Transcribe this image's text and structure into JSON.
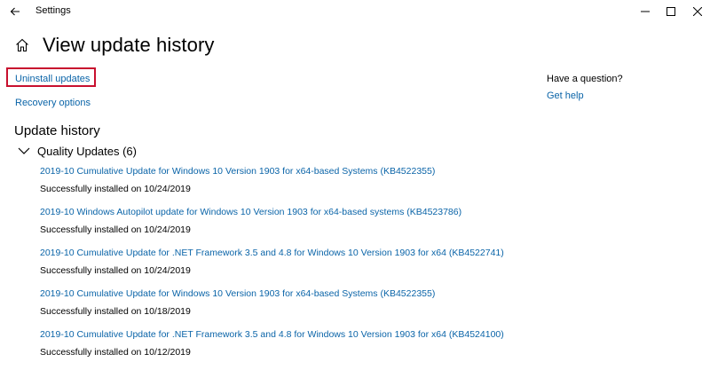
{
  "window": {
    "title": "Settings"
  },
  "header": {
    "title": "View update history"
  },
  "links": {
    "uninstall": "Uninstall updates",
    "recovery": "Recovery options"
  },
  "sidebar": {
    "heading": "Have a question?",
    "help_link": "Get help"
  },
  "history": {
    "heading": "Update history",
    "group_label": "Quality Updates (6)",
    "items": [
      {
        "title": "2019-10 Cumulative Update for Windows 10 Version 1903 for x64-based Systems (KB4522355)",
        "status": "Successfully installed on 10/24/2019"
      },
      {
        "title": "2019-10 Windows Autopilot update for Windows 10 Version 1903 for x64-based systems (KB4523786)",
        "status": "Successfully installed on 10/24/2019"
      },
      {
        "title": "2019-10 Cumulative Update for .NET Framework 3.5 and 4.8 for Windows 10 Version 1903 for x64 (KB4522741)",
        "status": "Successfully installed on 10/24/2019"
      },
      {
        "title": "2019-10 Cumulative Update for Windows 10 Version 1903 for x64-based Systems (KB4522355)",
        "status": "Successfully installed on 10/18/2019"
      },
      {
        "title": "2019-10 Cumulative Update for .NET Framework 3.5 and 4.8 for Windows 10 Version 1903 for x64 (KB4524100)",
        "status": "Successfully installed on 10/12/2019"
      }
    ]
  },
  "icons": {
    "back": "back-arrow-icon",
    "minimize": "minimize-icon",
    "maximize": "maximize-icon",
    "close": "close-icon",
    "home": "home-icon",
    "chevron": "chevron-down-icon"
  },
  "colors": {
    "link": "#0a64a8",
    "highlight_box": "#c8102e",
    "background": "#ffffff"
  }
}
